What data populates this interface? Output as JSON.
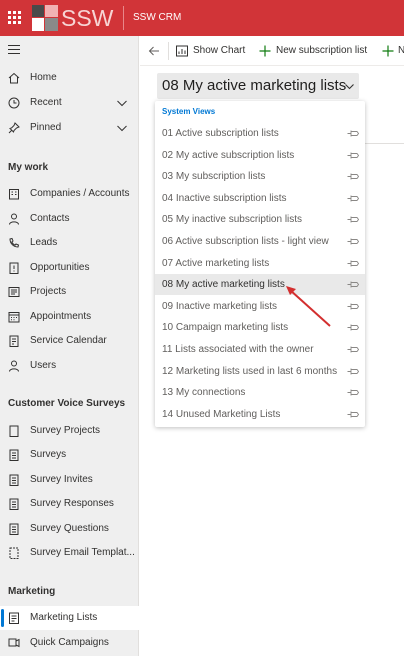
{
  "header": {
    "logo_text": "SSW",
    "app_name": "SSW CRM",
    "brand_color": "#d13438"
  },
  "sidebar": {
    "top_items": [
      {
        "label": "Home",
        "icon": "home-icon"
      },
      {
        "label": "Recent",
        "icon": "clock-icon"
      },
      {
        "label": "Pinned",
        "icon": "pin-icon"
      }
    ],
    "sections": [
      {
        "title": "My work",
        "items": [
          {
            "label": "Companies / Accounts",
            "icon": "building-icon"
          },
          {
            "label": "Contacts",
            "icon": "person-icon"
          },
          {
            "label": "Leads",
            "icon": "phone-person-icon"
          },
          {
            "label": "Opportunities",
            "icon": "opportunity-icon"
          },
          {
            "label": "Projects",
            "icon": "list-icon"
          },
          {
            "label": "Appointments",
            "icon": "calendar-icon"
          },
          {
            "label": "Service Calendar",
            "icon": "calendar-grid-icon"
          },
          {
            "label": "Users",
            "icon": "person-icon"
          }
        ]
      },
      {
        "title": "Customer Voice Surveys",
        "items": [
          {
            "label": "Survey Projects",
            "icon": "document-icon"
          },
          {
            "label": "Surveys",
            "icon": "document-list-icon"
          },
          {
            "label": "Survey Invites",
            "icon": "document-list-icon"
          },
          {
            "label": "Survey Responses",
            "icon": "document-list-icon"
          },
          {
            "label": "Survey Questions",
            "icon": "document-list-icon"
          },
          {
            "label": "Survey Email Templat...",
            "icon": "document-dashed-icon"
          }
        ]
      },
      {
        "title": "Marketing",
        "items": [
          {
            "label": "Marketing Lists",
            "icon": "marketing-list-icon",
            "active": true
          },
          {
            "label": "Quick Campaigns",
            "icon": "campaign-icon"
          }
        ]
      }
    ]
  },
  "commandbar": {
    "back_icon": "back-arrow-icon",
    "show_chart": "Show Chart",
    "new_subscription_list": "New subscription list",
    "overflow_label": "N"
  },
  "view_selector": {
    "current": "08 My active marketing lists"
  },
  "dropdown": {
    "group_label": "System Views",
    "items": [
      "01 Active subscription lists",
      "02 My active subscription lists",
      "03 My subscription lists",
      "04 Inactive subscription lists",
      "05 My inactive subscription lists",
      "06 Active subscription lists - light view",
      "07 Active marketing lists",
      "08 My active marketing lists",
      "09 Inactive marketing lists",
      "10 Campaign marketing lists",
      "11 Lists associated with the owner",
      "12 Marketing lists used in last 6 months",
      "13 My connections",
      "14 Unused Marketing Lists"
    ],
    "selected_index": 7,
    "annotation_color": "#d32f2f"
  }
}
